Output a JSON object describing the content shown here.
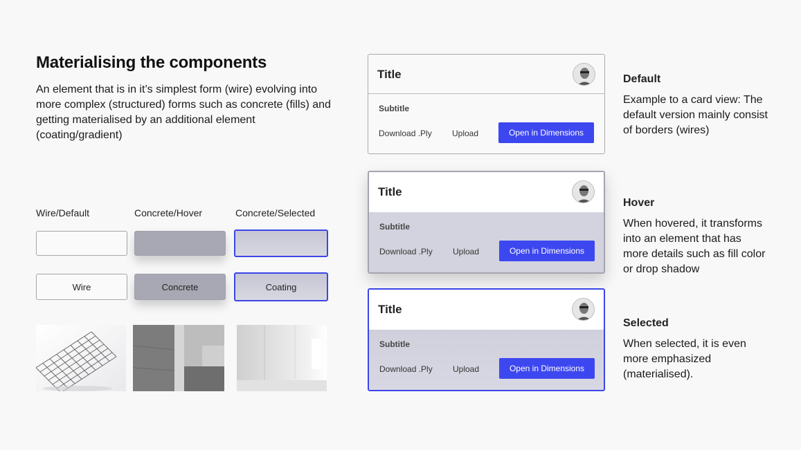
{
  "heading": "Materialising the components",
  "intro": "An element that is in it’s simplest form (wire) evolving into more complex (structured) forms such as concrete (fills) and getting materialised by an additional element (coating/gradient)",
  "columns": {
    "wire": "Wire/Default",
    "concrete": "Concrete/Hover",
    "selected": "Concrete/Selected"
  },
  "buttons": {
    "wire": "Wire",
    "concrete": "Concrete",
    "coating": "Coating"
  },
  "textures": [
    "wire-mesh-photo",
    "concrete-wall-photo",
    "coated-room-photo"
  ],
  "card": {
    "title": "Title",
    "subtitle": "Subtitle",
    "download": "Download .Ply",
    "upload": "Upload",
    "open": "Open in Dimensions"
  },
  "states": [
    {
      "title": "Default",
      "text": "Example to a card view: The default version mainly consist of borders (wires)"
    },
    {
      "title": "Hover",
      "text": "When hovered, it transforms into an element that has more details such as fill color or drop shadow"
    },
    {
      "title": "Selected",
      "text": "When selected, it is even more emphasized (materialised)."
    }
  ],
  "colors": {
    "accent": "#3d47f0",
    "concrete": "#a8a8b4",
    "background": "#f8f8f8"
  }
}
